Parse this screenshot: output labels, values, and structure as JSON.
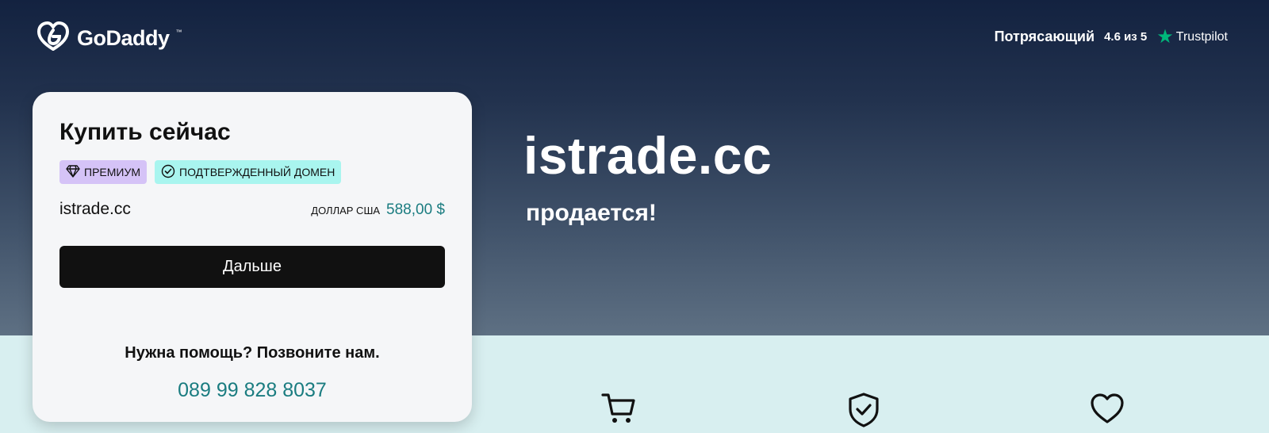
{
  "header": {
    "logo_text": "GoDaddy",
    "logo_tm": "™",
    "logo_icon": "godaddy-heart-icon",
    "trust_word": "Потрясающий",
    "trust_score": "4.6 из 5",
    "trust_star": "★",
    "trust_brand": "Trustpilot"
  },
  "card": {
    "title": "Купить сейчас",
    "badges": [
      {
        "label": "ПРЕМИУМ",
        "icon": "diamond-icon"
      },
      {
        "label": "ПОДТВЕРЖДЕННЫЙ ДОМЕН",
        "icon": "check-circle-icon"
      }
    ],
    "domain": "istrade.cc",
    "currency": "ДОЛЛАР США",
    "price": "588,00 $",
    "next_label": "Дальше",
    "help_text": "Нужна помощь? Позвоните нам.",
    "phone": "089 99 828 8037"
  },
  "hero": {
    "domain": "istrade.cc",
    "subtitle": "продается!"
  },
  "features": [
    {
      "icon": "cart-icon"
    },
    {
      "icon": "shield-check-icon"
    },
    {
      "icon": "heart-icon"
    }
  ],
  "colors": {
    "accent_teal": "#1a7c80",
    "button_black": "#111111",
    "trustpilot_green": "#00b67a",
    "badge_premium": "#d5c3f7",
    "badge_verified": "#a9f5ef",
    "bottom_band": "#d8eff0"
  }
}
